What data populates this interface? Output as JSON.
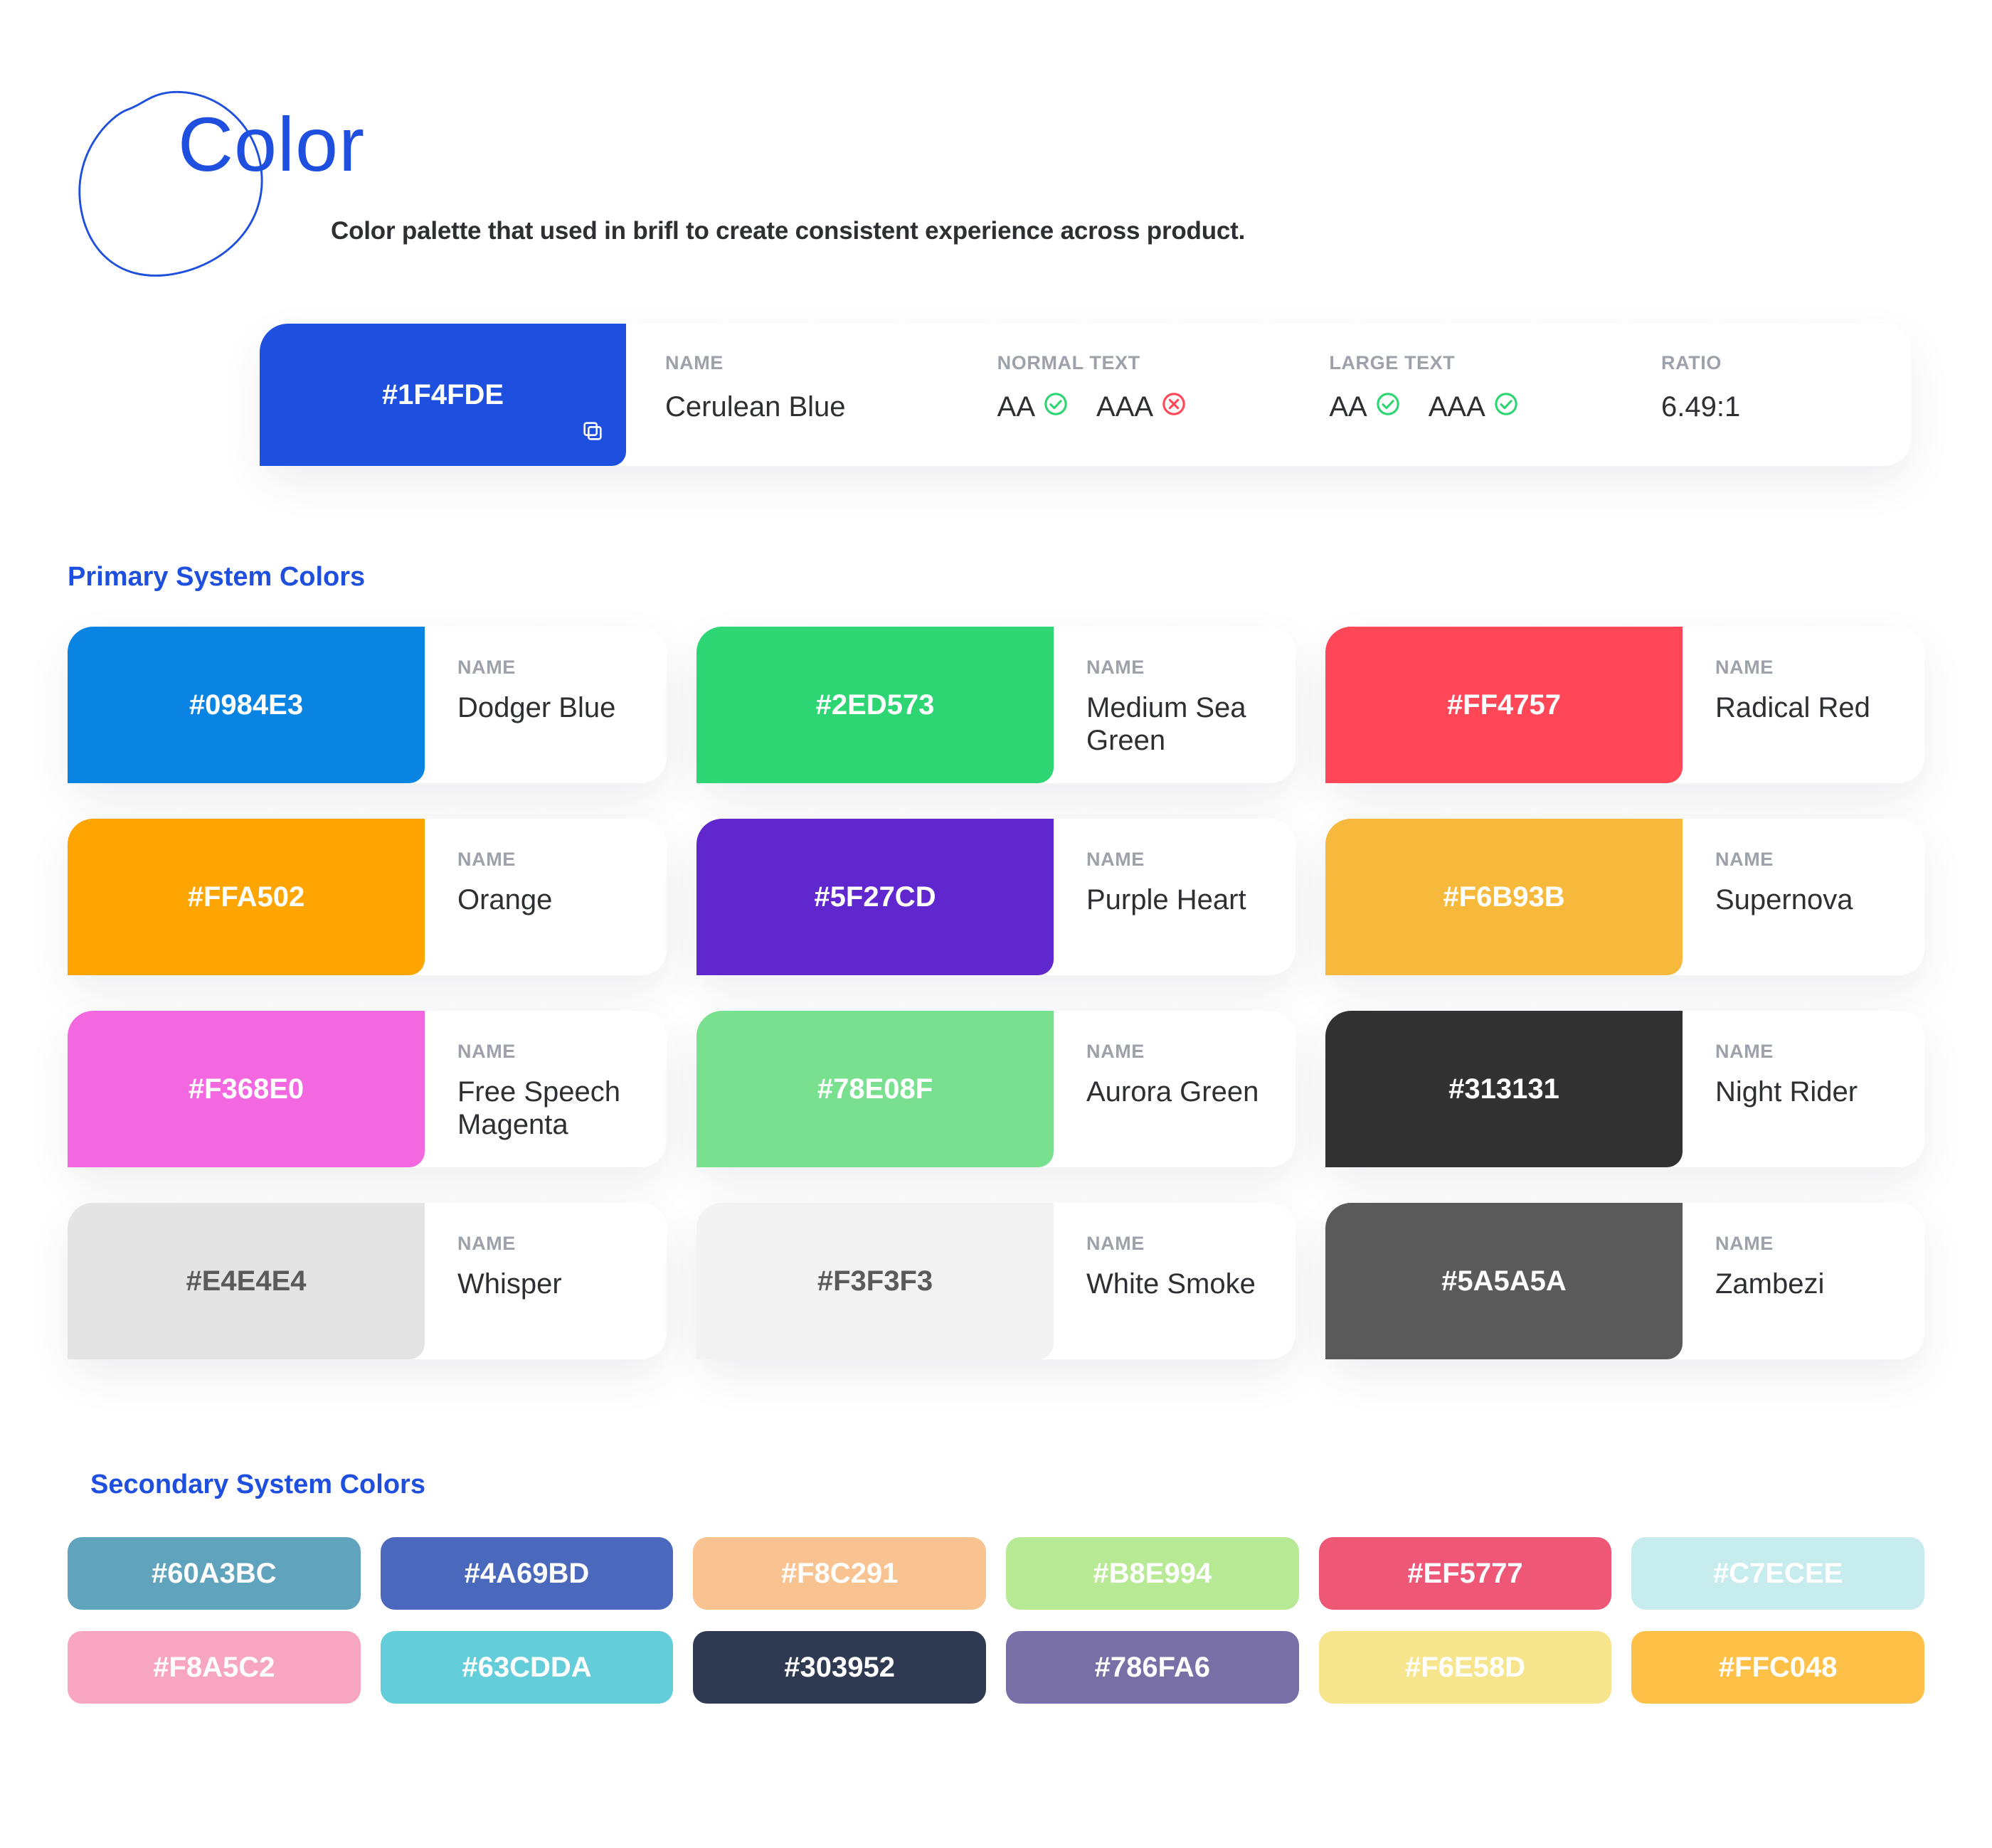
{
  "header": {
    "title": "Color",
    "subtitle": "Color palette that used in brifl to create consistent experience across product."
  },
  "featured": {
    "hex": "#1F4FDE",
    "text_color": "#FFFFFF",
    "labels": {
      "name": "NAME",
      "normal": "NORMAL TEXT",
      "large": "LARGE TEXT",
      "ratio": "RATIO"
    },
    "name": "Cerulean Blue",
    "normal": {
      "aa": {
        "label": "AA",
        "pass": true
      },
      "aaa": {
        "label": "AAA",
        "pass": false
      }
    },
    "large": {
      "aa": {
        "label": "AA",
        "pass": true
      },
      "aaa": {
        "label": "AAA",
        "pass": true
      }
    },
    "ratio": "6.49:1"
  },
  "section_primary": "Primary System Colors",
  "name_label": "NAME",
  "primary": [
    {
      "hex": "#0984E3",
      "name": "Dodger Blue",
      "text": "#FFFFFF"
    },
    {
      "hex": "#2ED573",
      "name": "Medium Sea Green",
      "text": "#FFFFFF"
    },
    {
      "hex": "#FF4757",
      "name": "Radical Red",
      "text": "#FFFFFF"
    },
    {
      "hex": "#FFA502",
      "name": "Orange",
      "text": "#FFFFFF"
    },
    {
      "hex": "#5F27CD",
      "name": "Purple Heart",
      "text": "#FFFFFF"
    },
    {
      "hex": "#F6B93B",
      "name": "Supernova",
      "text": "#FFFFFF"
    },
    {
      "hex": "#F368E0",
      "name": "Free Speech Magenta",
      "text": "#FFFFFF"
    },
    {
      "hex": "#78E08F",
      "name": "Aurora Green",
      "text": "#FFFFFF"
    },
    {
      "hex": "#313131",
      "name": "Night Rider",
      "text": "#FFFFFF"
    },
    {
      "hex": "#E4E4E4",
      "name": "Whisper",
      "text": "#5A5A5A"
    },
    {
      "hex": "#F3F3F3",
      "name": "White Smoke",
      "text": "#5A5A5A"
    },
    {
      "hex": "#5A5A5A",
      "name": "Zambezi",
      "text": "#FFFFFF"
    }
  ],
  "section_secondary": "Secondary System Colors",
  "secondary": [
    {
      "hex": "#60A3BC",
      "text": "#FFFFFF"
    },
    {
      "hex": "#4A69BD",
      "text": "#FFFFFF"
    },
    {
      "hex": "#F8C291",
      "text": "#FFFFFF"
    },
    {
      "hex": "#B8E994",
      "text": "#FFFFFF"
    },
    {
      "hex": "#EF5777",
      "text": "#FFFFFF"
    },
    {
      "hex": "#C7ECEE",
      "text": "#FFFFFF"
    },
    {
      "hex": "#F8A5C2",
      "text": "#FFFFFF"
    },
    {
      "hex": "#63CDDA",
      "text": "#FFFFFF"
    },
    {
      "hex": "#303952",
      "text": "#FFFFFF"
    },
    {
      "hex": "#786FA6",
      "text": "#FFFFFF"
    },
    {
      "hex": "#F6E58D",
      "text": "#FFFFFF"
    },
    {
      "hex": "#FFC048",
      "text": "#FFFFFF"
    }
  ]
}
